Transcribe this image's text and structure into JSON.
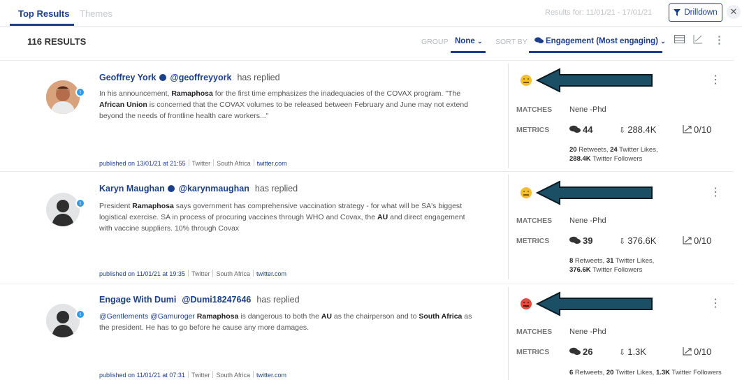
{
  "tabs": [
    {
      "label": "Top Results",
      "active": true
    },
    {
      "label": "Themes",
      "active": false
    }
  ],
  "results_for": "Results for: 11/01/21 - 17/01/21",
  "drilldown_label": "Drilldown",
  "results_count": "116 RESULTS",
  "group": {
    "label": "GROUP",
    "value": "None"
  },
  "sort": {
    "label": "SORT BY",
    "value": "Engagement (Most engaging)"
  },
  "colors": {
    "accent": "#1c3f8c",
    "arrow": "#1b4f66",
    "neutral": "#f5bf2e",
    "negative": "#e34b3f"
  },
  "results": [
    {
      "author": "Geoffrey York",
      "handle": "@geoffreyyork",
      "action": "has replied",
      "text_segments": [
        {
          "t": "In his announcement, ",
          "b": false
        },
        {
          "t": "Ramaphosa",
          "b": true
        },
        {
          "t": " for the first time emphasizes the inadequacies of the COVAX program. \"The ",
          "b": false
        },
        {
          "t": "African Union",
          "b": true
        },
        {
          "t": " is concerned that the COVAX volumes to be released between February and June may not extend beyond the needs of frontline health care workers...\"",
          "b": false
        }
      ],
      "published": "published on 13/01/21 at 21:55",
      "source": "Twitter",
      "country": "South Africa",
      "site": "twitter.com",
      "sentiment": "neutral",
      "matches_label": "MATCHES",
      "matches": "Nene -Phd",
      "metrics_label": "METRICS",
      "comments": "44",
      "reach": "288.4K",
      "trend": "0/10",
      "detail": {
        "retweets": "20",
        "retweets_label": " Retweets, ",
        "likes": "24",
        "likes_label": " Twitter Likes,",
        "followers": "288.4K",
        "followers_label": " Twitter Followers"
      }
    },
    {
      "author": "Karyn Maughan",
      "handle": "@karynmaughan",
      "action": "has replied",
      "text_segments": [
        {
          "t": "President ",
          "b": false
        },
        {
          "t": "Ramaphosa",
          "b": true
        },
        {
          "t": " says government has comprehensive vaccination strategy - for what will be SA's biggest logistical exercise. SA in process of procuring vaccines through WHO and Covax, the ",
          "b": false
        },
        {
          "t": "AU",
          "b": true
        },
        {
          "t": " and direct engagement with vaccine suppliers. 10% through Covax",
          "b": false
        }
      ],
      "published": "published on 11/01/21 at 19:35",
      "source": "Twitter",
      "country": "South Africa",
      "site": "twitter.com",
      "sentiment": "neutral",
      "matches_label": "MATCHES",
      "matches": "Nene -Phd",
      "metrics_label": "METRICS",
      "comments": "39",
      "reach": "376.6K",
      "trend": "0/10",
      "detail": {
        "retweets": "8",
        "retweets_label": " Retweets, ",
        "likes": "31",
        "likes_label": " Twitter Likes,",
        "followers": "376.6K",
        "followers_label": " Twitter Followers"
      }
    },
    {
      "author": "Engage With Dumi",
      "handle": "@Dumi18247646",
      "action": "has replied",
      "text_segments": [
        {
          "t": "@Gentlements @Gamuroger",
          "b": false,
          "mention": true
        },
        {
          "t": " ",
          "b": false
        },
        {
          "t": "Ramaphosa",
          "b": true
        },
        {
          "t": " is dangerous to both the ",
          "b": false
        },
        {
          "t": "AU",
          "b": true
        },
        {
          "t": " as the chairperson and to ",
          "b": false
        },
        {
          "t": "South Africa",
          "b": true
        },
        {
          "t": " as the president. He has to go before he cause any more damages.",
          "b": false
        }
      ],
      "published": "published on 11/01/21 at 07:31",
      "source": "Twitter",
      "country": "South Africa",
      "site": "twitter.com",
      "sentiment": "negative",
      "matches_label": "MATCHES",
      "matches": "Nene -Phd",
      "metrics_label": "METRICS",
      "comments": "26",
      "reach": "1.3K",
      "trend": "0/10",
      "detail": {
        "retweets": "6",
        "retweets_label": " Retweets, ",
        "likes": "20",
        "likes_label": " Twitter Likes, ",
        "followers": "1.3K",
        "followers_label": " Twitter Followers"
      }
    }
  ]
}
